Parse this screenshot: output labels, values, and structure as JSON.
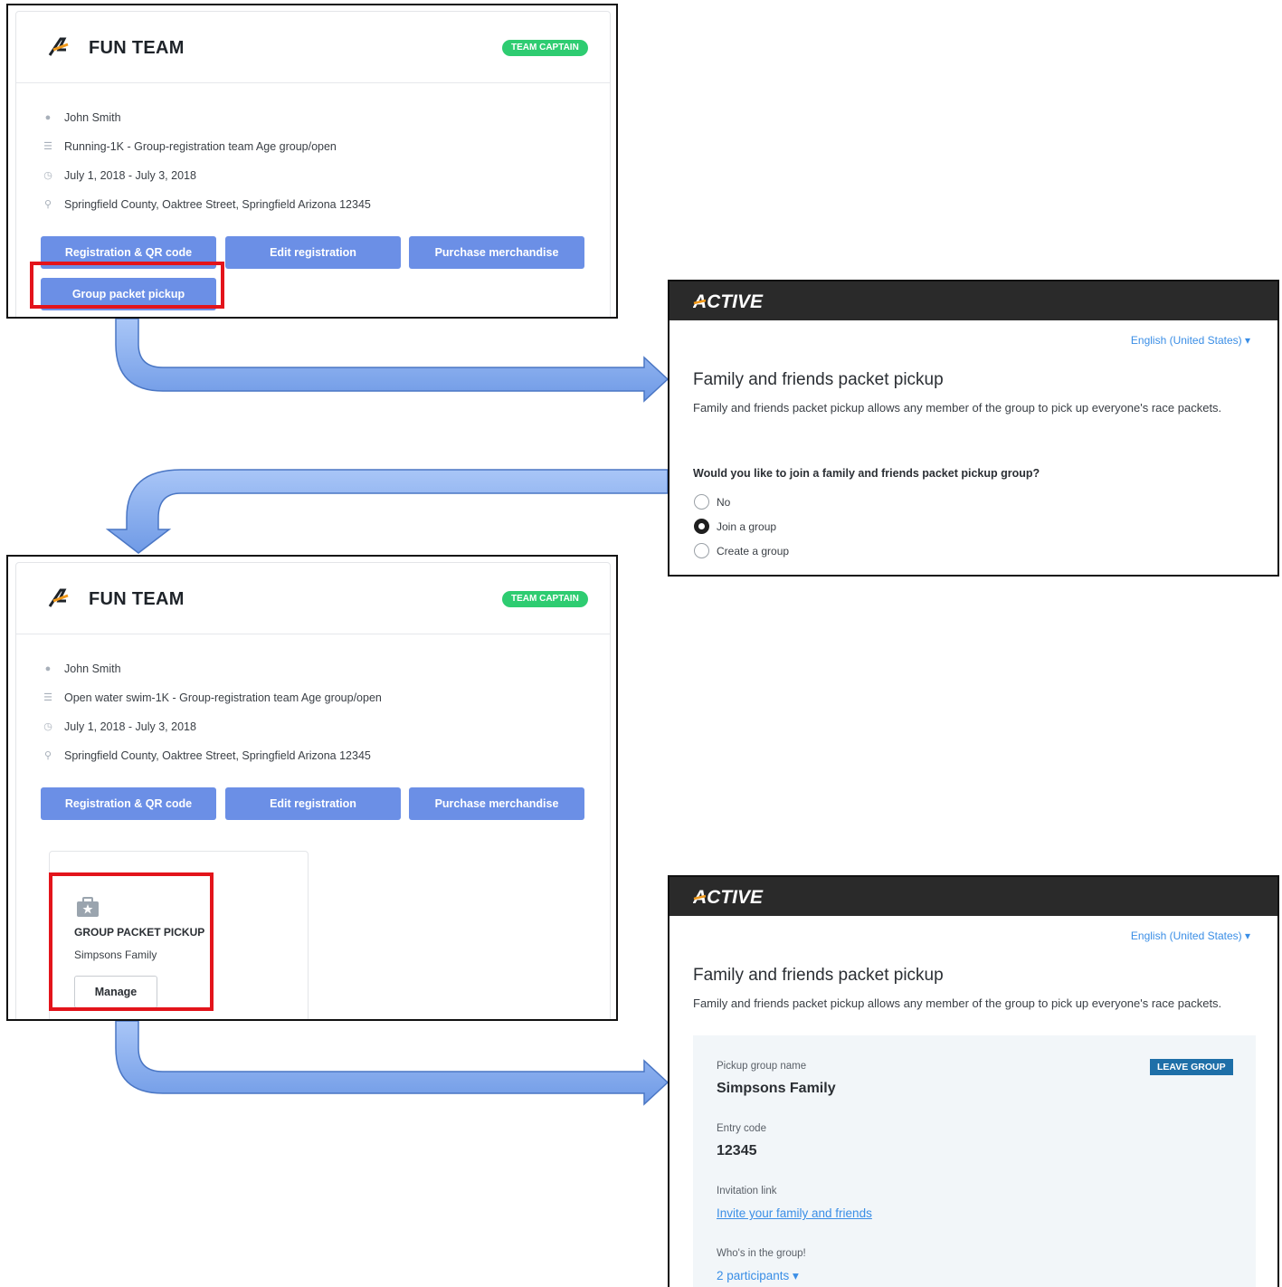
{
  "card1": {
    "team_name": "FUN TEAM",
    "badge": "TEAM CAPTAIN",
    "person": "John Smith",
    "event": "Running-1K - Group-registration team Age group/open",
    "dates": "July 1, 2018 - July 3, 2018",
    "location": "Springfield County, Oaktree Street, Springfield Arizona 12345",
    "buttons": [
      "Registration & QR code",
      "Edit registration",
      "Purchase merchandise",
      "Group packet pickup"
    ]
  },
  "card2": {
    "team_name": "FUN TEAM",
    "badge": "TEAM CAPTAIN",
    "person": "John Smith",
    "event": "Open water swim-1K - Group-registration team Age group/open",
    "dates": "July 1, 2018 - July 3, 2018",
    "location": "Springfield County, Oaktree Street, Springfield Arizona 12345",
    "buttons": [
      "Registration & QR code",
      "Edit registration",
      "Purchase merchandise"
    ],
    "gpp_title": "GROUP PACKET PICKUP",
    "gpp_group": "Simpsons Family",
    "gpp_manage": "Manage"
  },
  "join_form": {
    "logo": "ACTIVE",
    "language": "English (United States) ▾",
    "title": "Family and friends packet pickup",
    "description": "Family and friends packet pickup allows any member of the group to pick up everyone's race packets.",
    "question": "Would you like to join a family and friends packet pickup group?",
    "options": [
      "No",
      "Join a group",
      "Create a group"
    ],
    "selected": "Join a group"
  },
  "group_view": {
    "logo": "ACTIVE",
    "language": "English (United States) ▾",
    "title": "Family and friends packet pickup",
    "description": "Family and friends packet pickup allows any member of the group to pick up everyone's race packets.",
    "group_name_label": "Pickup group name",
    "group_name": "Simpsons Family",
    "leave_label": "LEAVE GROUP",
    "entry_code_label": "Entry code",
    "entry_code": "12345",
    "invite_label": "Invitation link",
    "invite_link": "Invite your family and friends",
    "members_label": "Who's in the group!",
    "members": "2 participants ▾"
  },
  "colors": {
    "button": "#6b8fe6",
    "badge": "#2ecc71",
    "highlight": "#e3141b",
    "active_bar": "#2a2a2a",
    "link": "#3a8ee6",
    "leave_button": "#1e6fa8",
    "arrow": "#8fb3f0"
  }
}
